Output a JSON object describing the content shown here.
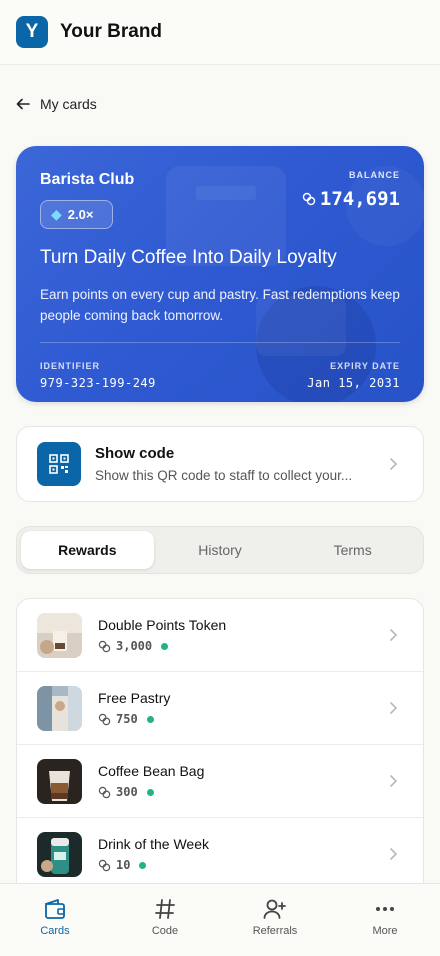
{
  "header": {
    "logo_letter": "Y",
    "brand": "Your Brand"
  },
  "back": {
    "label": "My cards"
  },
  "card": {
    "name": "Barista Club",
    "tier": "2.0×",
    "balance_label": "BALANCE",
    "balance_value": "174,691",
    "headline": "Turn Daily Coffee Into Daily Loyalty",
    "description": "Earn points on every cup and pastry. Fast redemptions keep people coming back tomorrow.",
    "identifier_label": "IDENTIFIER",
    "identifier_value": "979-323-199-249",
    "expiry_label": "EXPIRY DATE",
    "expiry_value": "Jan 15, 2031",
    "color": "#2f5ad2"
  },
  "show_code": {
    "title": "Show code",
    "subtitle": "Show this QR code to staff to collect your..."
  },
  "tabs": [
    {
      "label": "Rewards",
      "active": true
    },
    {
      "label": "History",
      "active": false
    },
    {
      "label": "Terms",
      "active": false
    }
  ],
  "rewards": [
    {
      "name": "Double Points Token",
      "points": "3,000",
      "status_color": "#1fb57d"
    },
    {
      "name": "Free Pastry",
      "points": "750",
      "status_color": "#1fb57d"
    },
    {
      "name": "Coffee Bean Bag",
      "points": "300",
      "status_color": "#1fb57d"
    },
    {
      "name": "Drink of the Week",
      "points": "10",
      "status_color": "#1fb57d"
    }
  ],
  "nav": [
    {
      "label": "Cards",
      "icon": "wallet-icon",
      "active": true
    },
    {
      "label": "Code",
      "icon": "hash-icon",
      "active": false
    },
    {
      "label": "Referrals",
      "icon": "add-user-icon",
      "active": false
    },
    {
      "label": "More",
      "icon": "more-icon",
      "active": false
    }
  ],
  "colors": {
    "brand": "#0b66a8",
    "accent_green": "#1fb57d"
  }
}
